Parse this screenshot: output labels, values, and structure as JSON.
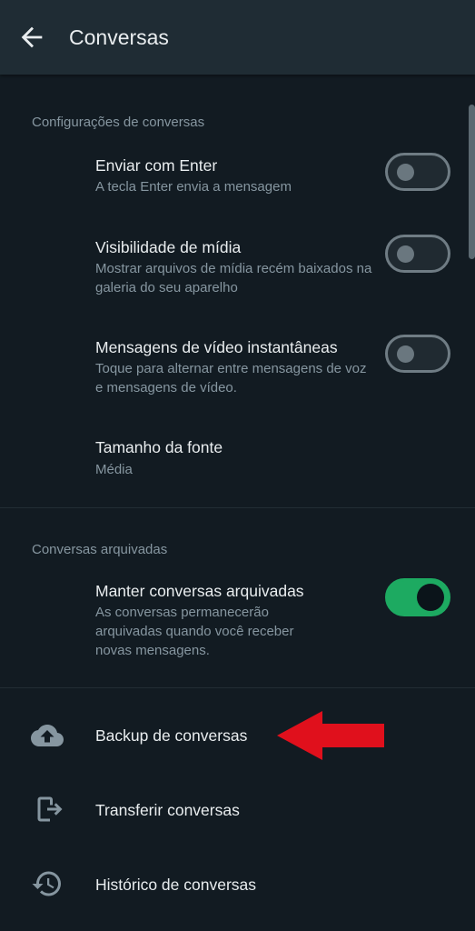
{
  "header": {
    "title": "Conversas",
    "back_icon": "arrow-left-icon"
  },
  "sections": {
    "settings": {
      "header": "Configurações de conversas",
      "items": [
        {
          "title": "Enviar com Enter",
          "subtitle": "A tecla Enter envia a mensagem",
          "toggle": false
        },
        {
          "title": "Visibilidade de mídia",
          "subtitle": "Mostrar arquivos de mídia recém baixados na galeria do seu aparelho",
          "toggle": false
        },
        {
          "title": "Mensagens de vídeo instantâneas",
          "subtitle": "Toque para alternar entre mensagens de voz e mensagens de vídeo.",
          "toggle": false
        },
        {
          "title": "Tamanho da fonte",
          "subtitle": "Média"
        }
      ]
    },
    "archived": {
      "header": "Conversas arquivadas",
      "items": [
        {
          "title": "Manter conversas arquivadas",
          "subtitle": "As conversas permanecerão arquivadas quando você receber novas mensagens.",
          "toggle": true
        }
      ]
    }
  },
  "menu": [
    {
      "label": "Backup de conversas",
      "icon": "cloud-upload-icon"
    },
    {
      "label": "Transferir conversas",
      "icon": "phone-transfer-icon"
    },
    {
      "label": "Histórico de conversas",
      "icon": "history-icon"
    }
  ],
  "colors": {
    "background": "#121b22",
    "topbar": "#1f2c34",
    "accent_green": "#1daa61",
    "annotation_arrow": "#e0101c"
  }
}
